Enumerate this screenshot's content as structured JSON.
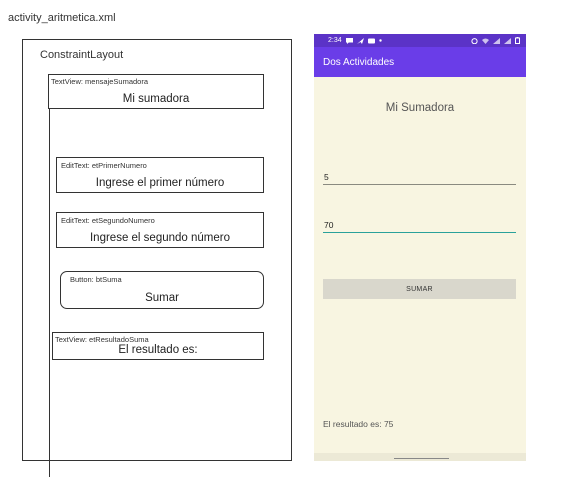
{
  "file_title": "activity_aritmetica.xml",
  "wireframe": {
    "layout_label": "ConstraintLayout",
    "components": [
      {
        "caption": "TextView: mensajeSumadora",
        "text": "Mi sumadora"
      },
      {
        "caption": "EditText: etPrimerNumero",
        "text": "Ingrese el primer número"
      },
      {
        "caption": "EditText: etSegundoNumero",
        "text": "Ingrese el segundo número"
      },
      {
        "caption": "Button: btSuma",
        "text": "Sumar"
      },
      {
        "caption": "TextView: etResultadoSuma",
        "text": "El resultado es:"
      }
    ]
  },
  "phone": {
    "status_bar": {
      "time": "2:34"
    },
    "app_title": "Dos Actividades",
    "header_text": "Mi Sumadora",
    "first_number_value": "5",
    "second_number_value": "70",
    "button_label": "SUMAR",
    "result_text": "El resultado es: 75",
    "colors": {
      "status_bar": "#5b33c7",
      "app_bar": "#6a3de8",
      "background": "#f8f5e1",
      "focus_underline": "#2aa19a",
      "button": "#d9d7cc"
    }
  }
}
